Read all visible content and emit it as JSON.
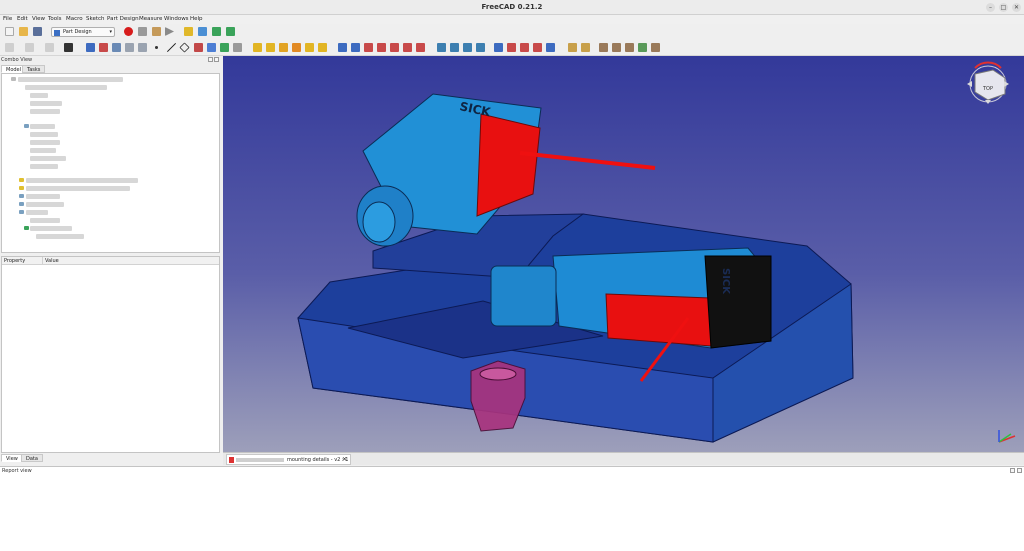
{
  "window": {
    "title": "FreeCAD 0.21.2",
    "controls": [
      "–",
      "□",
      "✕"
    ]
  },
  "menubar": {
    "items": [
      "File",
      "Edit",
      "View",
      "Tools",
      "Macro",
      "Sketch",
      "Part Design",
      "Measure",
      "Windows",
      "Help"
    ]
  },
  "toolbar": {
    "workbench": "Part Design"
  },
  "combo_view": {
    "title": "Combo View",
    "tabs": [
      "Model",
      "Tasks"
    ],
    "bottom_tabs": [
      "View",
      "Data"
    ]
  },
  "property_editor": {
    "columns": [
      "Property",
      "Value"
    ]
  },
  "viewport": {
    "label_top": "SICK",
    "label_bottom": "SICK",
    "navcube_face": "TOP"
  },
  "document_tab": {
    "name": "mounting details - v2 : 1"
  },
  "report_view": {
    "title": "Report view"
  },
  "colors": {
    "viewport_top": "#33399a",
    "viewport_bottom": "#9d9fba",
    "part_blue": "#1f4aa6",
    "sensor_cyan": "#2a8fd8",
    "sensor_red": "#e81010",
    "nut_magenta": "#a0307a"
  }
}
